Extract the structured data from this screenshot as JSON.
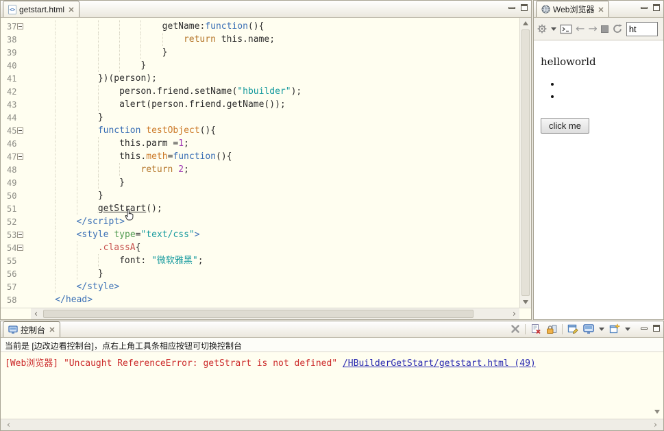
{
  "editor": {
    "tab_title": "getstart.html",
    "colors": {
      "plain": "#2e2e2e",
      "keyword": "#3a6fb5",
      "keyword2": "#b5762a",
      "string": "#169a9e",
      "number": "#a13bb5",
      "func": "#cc7a29",
      "classsel": "#c75450",
      "attr": "#4f9a4f",
      "lineno": "#8b8b84"
    },
    "lines": [
      {
        "no": 37,
        "fold": true,
        "indent": 24,
        "segs": [
          {
            "c": "t",
            "x": "getName:"
          },
          {
            "c": "k",
            "x": "function"
          },
          {
            "c": "t",
            "x": "(){"
          }
        ]
      },
      {
        "no": 38,
        "indent": 28,
        "segs": [
          {
            "c": "r",
            "x": "return"
          },
          {
            "c": "t",
            "x": " this.name;"
          }
        ]
      },
      {
        "no": 39,
        "indent": 24,
        "segs": [
          {
            "c": "t",
            "x": "}"
          }
        ]
      },
      {
        "no": 40,
        "indent": 20,
        "segs": [
          {
            "c": "t",
            "x": "}"
          }
        ]
      },
      {
        "no": 41,
        "indent": 12,
        "segs": [
          {
            "c": "t",
            "x": "})(person);"
          }
        ]
      },
      {
        "no": 42,
        "indent": 16,
        "segs": [
          {
            "c": "t",
            "x": "person.friend.setName("
          },
          {
            "c": "s",
            "x": "\"hbuilder\""
          },
          {
            "c": "t",
            "x": ");"
          }
        ]
      },
      {
        "no": 43,
        "indent": 16,
        "segs": [
          {
            "c": "t",
            "x": "alert(person.friend.getName());"
          }
        ]
      },
      {
        "no": 44,
        "indent": 12,
        "segs": [
          {
            "c": "t",
            "x": "}"
          }
        ]
      },
      {
        "no": 45,
        "fold": true,
        "indent": 12,
        "segs": [
          {
            "c": "k",
            "x": "function "
          },
          {
            "c": "f",
            "x": "testObject"
          },
          {
            "c": "t",
            "x": "(){"
          }
        ]
      },
      {
        "no": 46,
        "indent": 16,
        "segs": [
          {
            "c": "t",
            "x": "this.parm ="
          },
          {
            "c": "n",
            "x": "1"
          },
          {
            "c": "t",
            "x": ";"
          }
        ]
      },
      {
        "no": 47,
        "fold": true,
        "indent": 16,
        "segs": [
          {
            "c": "t",
            "x": "this."
          },
          {
            "c": "f",
            "x": "meth"
          },
          {
            "c": "t",
            "x": "="
          },
          {
            "c": "k",
            "x": "function"
          },
          {
            "c": "t",
            "x": "(){"
          }
        ]
      },
      {
        "no": 48,
        "indent": 20,
        "segs": [
          {
            "c": "r",
            "x": "return "
          },
          {
            "c": "n",
            "x": "2"
          },
          {
            "c": "t",
            "x": ";"
          }
        ]
      },
      {
        "no": 49,
        "indent": 16,
        "segs": [
          {
            "c": "t",
            "x": "}"
          }
        ]
      },
      {
        "no": 50,
        "indent": 12,
        "segs": [
          {
            "c": "t",
            "x": "}"
          }
        ]
      },
      {
        "no": 51,
        "indent": 12,
        "segs": [
          {
            "c": "u",
            "x": "getStrart"
          },
          {
            "c": "t",
            "x": "();"
          }
        ]
      },
      {
        "no": 52,
        "indent": 8,
        "segs": [
          {
            "c": "k",
            "x": "</script>"
          }
        ]
      },
      {
        "no": 53,
        "fold": true,
        "indent": 8,
        "segs": [
          {
            "c": "k",
            "x": "<style"
          },
          {
            "c": "t",
            "x": " "
          },
          {
            "c": "a",
            "x": "type"
          },
          {
            "c": "t",
            "x": "="
          },
          {
            "c": "s",
            "x": "\"text/css\""
          },
          {
            "c": "k",
            "x": ">"
          }
        ]
      },
      {
        "no": 54,
        "fold": true,
        "indent": 12,
        "segs": [
          {
            "c": "cl",
            "x": ".classA"
          },
          {
            "c": "t",
            "x": "{"
          }
        ]
      },
      {
        "no": 55,
        "indent": 16,
        "segs": [
          {
            "c": "t",
            "x": "font: "
          },
          {
            "c": "s",
            "x": "\"微软雅黑\""
          },
          {
            "c": "t",
            "x": ";"
          }
        ]
      },
      {
        "no": 56,
        "indent": 12,
        "segs": [
          {
            "c": "t",
            "x": "}"
          }
        ]
      },
      {
        "no": 57,
        "indent": 8,
        "segs": [
          {
            "c": "k",
            "x": "</style>"
          }
        ]
      },
      {
        "no": 58,
        "indent": 4,
        "segs": [
          {
            "c": "k",
            "x": "</head>"
          }
        ]
      }
    ]
  },
  "browser": {
    "tab_title": "Web浏览器",
    "url_value": "ht",
    "page": {
      "heading": "helloworld",
      "list_items": [
        "",
        ""
      ],
      "button_label": "click me"
    }
  },
  "console": {
    "tab_title": "控制台",
    "info_text": "当前是 [边改边看控制台]，点右上角工具条相应按钮可切换控制台",
    "error": {
      "source": "[Web浏览器] ",
      "message": "\"Uncaught ReferenceError: getStrart is not defined\" ",
      "link": "/HBuilderGetStart/getstart.html (49)"
    },
    "colors": {
      "error": "#cc2b2b",
      "link": "#2929b0"
    }
  }
}
